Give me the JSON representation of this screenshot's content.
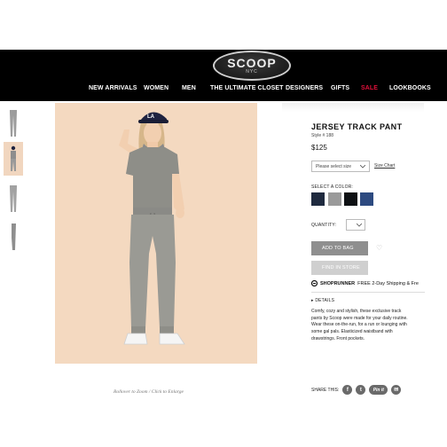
{
  "brand": {
    "name": "SCOOP",
    "sub": "NYC"
  },
  "nav": {
    "items": [
      {
        "label": "NEW ARRIVALS"
      },
      {
        "label": "WOMEN"
      },
      {
        "label": "MEN"
      },
      {
        "label": "THE ULTIMATE CLOSET"
      },
      {
        "label": "DESIGNERS"
      },
      {
        "label": "GIFTS"
      },
      {
        "label": "SALE"
      },
      {
        "label": "LOOKBOOKS"
      }
    ],
    "sale_color": "#e0103a"
  },
  "gallery": {
    "thumbnails": [
      {
        "name": "thumb-pant-front",
        "active": false
      },
      {
        "name": "thumb-model",
        "active": true
      },
      {
        "name": "thumb-pant-back",
        "active": false
      },
      {
        "name": "thumb-pant-side",
        "active": false
      }
    ],
    "caption": "Rollover to Zoom / Click to Enlarge",
    "cap_text": "LA"
  },
  "product": {
    "title": "JERSEY TRACK PANT",
    "style": "Style # 188",
    "price": "$125",
    "size_placeholder": "Please select size",
    "size_chart_label": "Size Chart",
    "color_label": "SELECT A COLOR:",
    "colors": [
      "#1f2a3f",
      "#9a9a9a",
      "#0e1114",
      "#2d4a80"
    ],
    "quantity_label": "QUANTITY:",
    "quantity_value": "",
    "add_to_bag_label": "ADD TO BAG",
    "find_in_store_label": "FIND IN STORE",
    "shoprunner": {
      "brand": "SHOPRUNNER",
      "offer": "FREE 2-Day Shipping & Fre"
    },
    "details_label": "DETAILS",
    "details_text": "Comfy, cozy and stylish, these exclusive track pants by Scoop were made for your daily routine. Wear these on-the-run, for a run or lounging with some gal pals. Elasticized waistband with drawstrings. Front pockets.",
    "share_label": "SHARE THIS:",
    "share_icons": [
      "facebook-icon",
      "twitter-icon",
      "pinterest-icon",
      "email-icon"
    ],
    "pin_label": "Pin it"
  }
}
